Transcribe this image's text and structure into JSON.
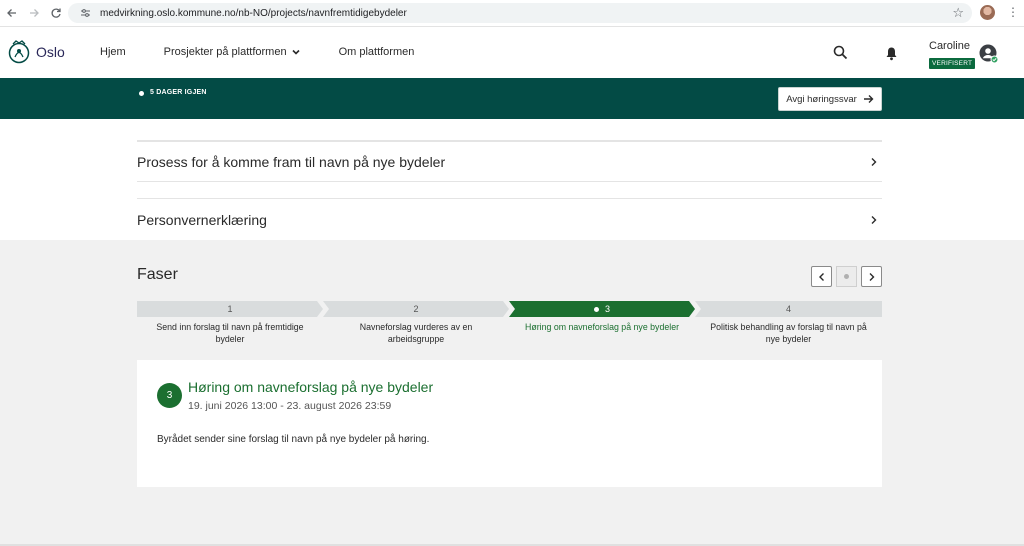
{
  "browser": {
    "url": "medvirkning.oslo.kommune.no/nb-NO/projects/navnfremtidigebydeler",
    "icons": [
      "back-icon",
      "forward-icon",
      "reload-icon",
      "site-settings-icon",
      "bookmark-star-icon",
      "profile-avatar",
      "menu-kebab-icon"
    ]
  },
  "header": {
    "logo_text": "Oslo",
    "nav": [
      {
        "label": "Hjem"
      },
      {
        "label": "Prosjekter på plattformen",
        "has_dropdown": true
      },
      {
        "label": "Om plattformen"
      }
    ],
    "user": {
      "name": "Caroline",
      "badge": "VERIFISERT"
    }
  },
  "banner": {
    "remaining": "5 DAGER IGJEN",
    "cta_label": "Avgi høringssvar"
  },
  "accordion": [
    {
      "title": "Prosess for å komme fram til navn på nye bydeler"
    },
    {
      "title": "Personvernerklæring"
    }
  ],
  "phases": {
    "title": "Faser",
    "steps": [
      {
        "number": "1",
        "label_line1": "Send inn forslag til navn på fremtidige",
        "label_line2": "bydeler",
        "active": false
      },
      {
        "number": "2",
        "label_line1": "Navneforslag vurderes av en",
        "label_line2": "arbeidsgruppe",
        "active": false
      },
      {
        "number": "3",
        "label_line1": "Høring om navneforslag på nye bydeler",
        "label_line2": "",
        "active": true
      },
      {
        "number": "4",
        "label_line1": "Politisk behandling av forslag til navn på",
        "label_line2": "nye bydeler",
        "active": false
      }
    ],
    "current": {
      "number": "3",
      "title": "Høring om navneforslag på nye bydeler",
      "dates": "19. juni 2026 13:00 - 23. august 2026 23:59",
      "description": "Byrådet sender sine forslag til navn på nye bydeler på høring."
    }
  },
  "colors": {
    "brand_dark_green": "#034b45",
    "active_green": "#1b6f30",
    "badge_green": "#0b6a3e",
    "grey_section": "#f1f1f1"
  }
}
